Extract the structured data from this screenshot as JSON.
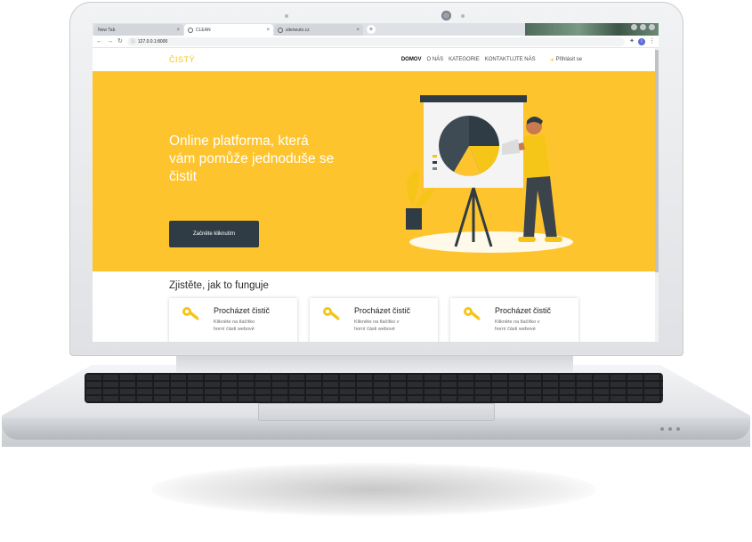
{
  "browser": {
    "tabs": [
      {
        "label": "New Tab",
        "active": false
      },
      {
        "label": "CLEAN",
        "active": true
      },
      {
        "label": "siteneuto.cz",
        "active": false
      }
    ],
    "new_tab_symbol": "+",
    "url": "127.0.0.1:8000",
    "profile_initial": "I"
  },
  "site": {
    "logo": "ČISTÝ",
    "menu": [
      "DOMOV",
      "O NÁS",
      "KATEGORIE",
      "KONTAKTUJTE NÁS"
    ],
    "login": "Přihlásit se",
    "accent": "#fec42d",
    "brand": "#f5c518",
    "button_color": "#2f3c45"
  },
  "hero": {
    "title_lines": [
      "Online platforma, která",
      "vám pomůže jednoduše se",
      "čistit"
    ],
    "cta": "Začněte kliknutím"
  },
  "how": {
    "title": "Zjistěte, jak to funguje",
    "cards": [
      {
        "title": "Procházet čistič",
        "text_lines": [
          "Klikněte na tlačítko",
          "horní části webové"
        ]
      },
      {
        "title": "Procházet čistič",
        "text_lines": [
          "Klikněte na tlačítko v",
          "horní části webové"
        ]
      },
      {
        "title": "Procházet čistič",
        "text_lines": [
          "Klikněte na tlačítko v",
          "horní části webové"
        ]
      }
    ]
  },
  "icons": {
    "card_icon": "key-icon",
    "login_icon": "login-arrow-icon",
    "illustration": "presenter-pie-chart-illustration"
  }
}
